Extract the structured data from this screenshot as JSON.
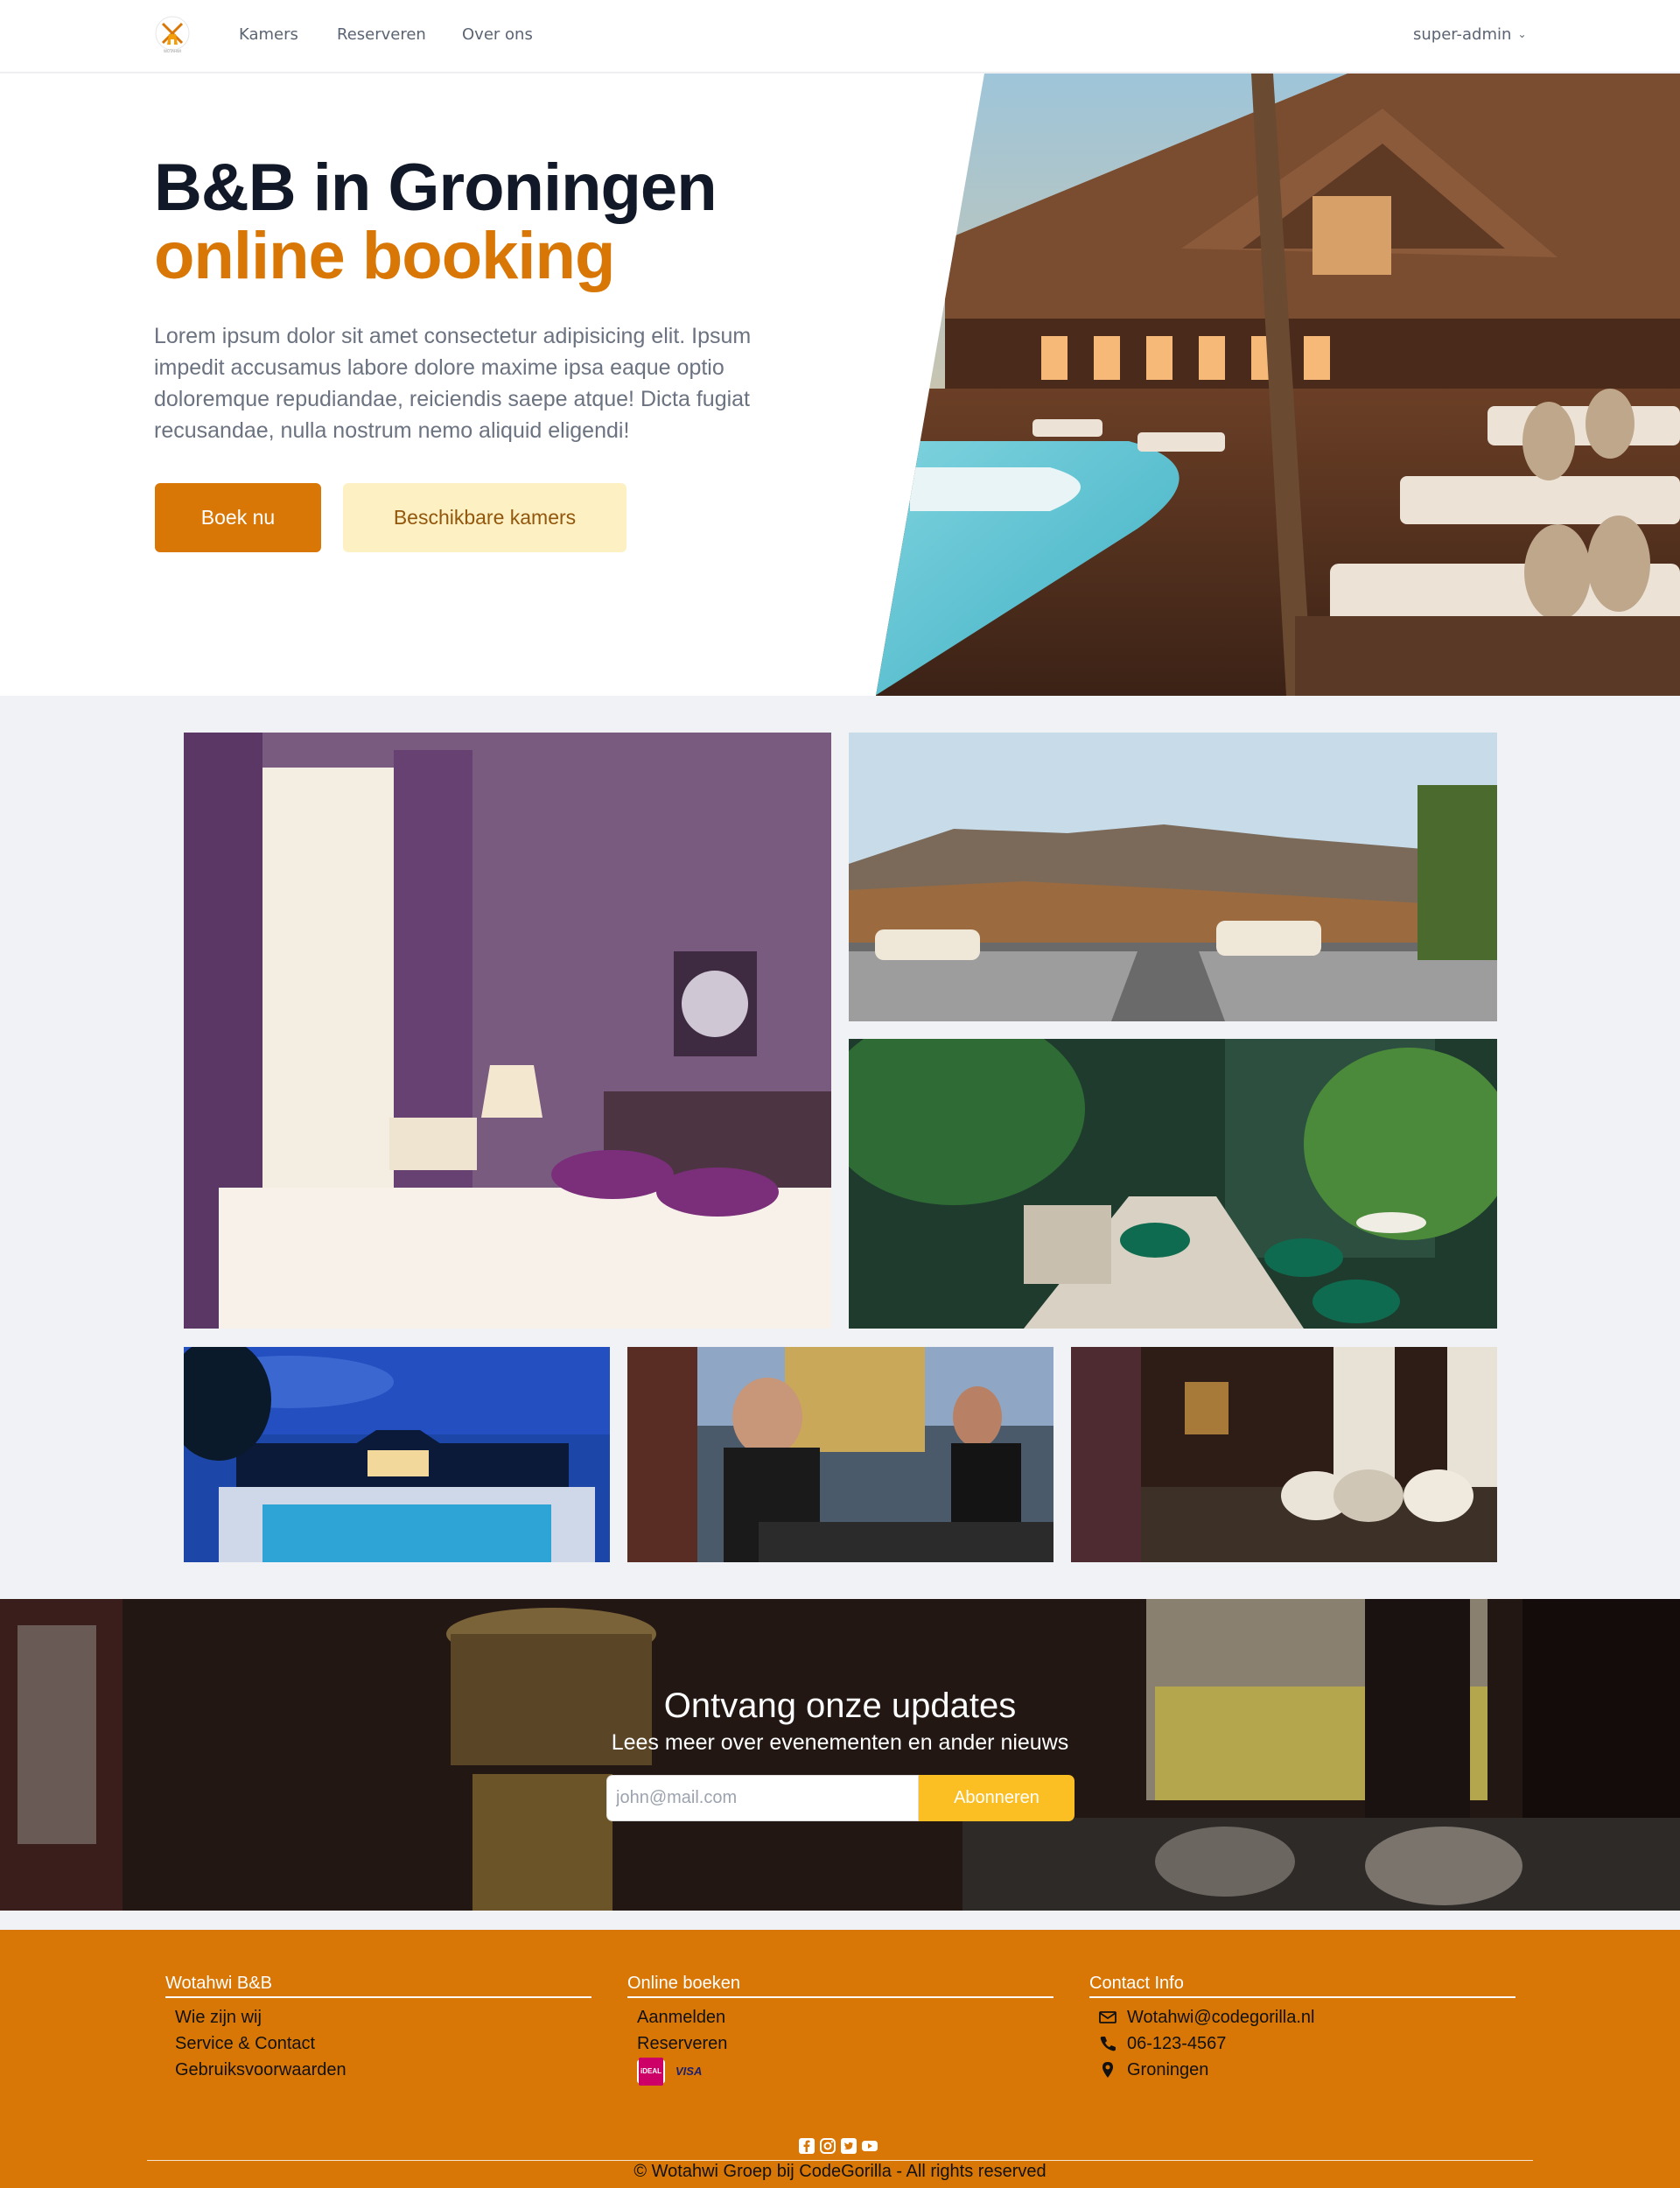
{
  "nav": {
    "links": [
      "Kamers",
      "Reserveren",
      "Over ons"
    ],
    "user": "super-admin",
    "logo_text": "WOTAHWI"
  },
  "hero": {
    "title_line1": "B&B in Groningen",
    "title_line2": "online booking",
    "description": "Lorem ipsum dolor sit amet consectetur adipisicing elit. Ipsum impedit accusamus labore dolore maxime ipsa eaque optio doloremque repudiandae, reiciendis saepe atque! Dicta fugiat recusandae, nulla nostrum nemo aliquid eligendi!",
    "primary_button": "Boek nu",
    "secondary_button": "Beschikbare kamers"
  },
  "newsletter": {
    "title": "Ontvang onze updates",
    "subtitle": "Lees meer over evenementen en ander nieuws",
    "placeholder": "john@mail.com",
    "button": "Abonneren"
  },
  "footer": {
    "col1": {
      "title": "Wotahwi B&B",
      "items": [
        "Wie zijn wij",
        "Service & Contact",
        "Gebruiksvoorwaarden"
      ]
    },
    "col2": {
      "title": "Online boeken",
      "items": [
        "Aanmelden",
        "Reserveren"
      ],
      "payment": [
        "iDEAL",
        "VISA"
      ]
    },
    "col3": {
      "title": "Contact Info",
      "email": "Wotahwi@codegorilla.nl",
      "phone": "06-123-4567",
      "location": "Groningen"
    },
    "socials": [
      "facebook-icon",
      "instagram-icon",
      "twitter-icon",
      "youtube-icon"
    ],
    "copyright": "© Wotahwi Groep bij CodeGorilla - All rights reserved"
  },
  "colors": {
    "accent": "#d97706",
    "accent_light": "#fdf1c4",
    "subscribe": "#fbbf24",
    "heading": "#111827"
  }
}
